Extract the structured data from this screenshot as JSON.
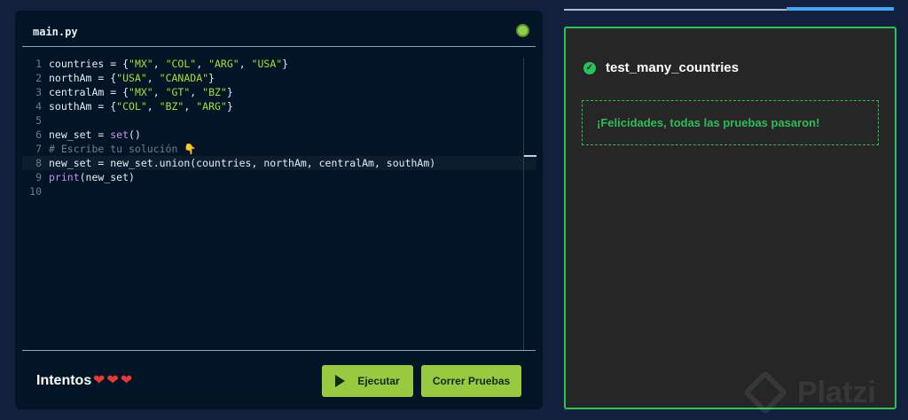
{
  "editor": {
    "file_name": "main.py",
    "lines": [
      {
        "num": "1",
        "tokens": [
          {
            "t": "countries = {",
            "c": "text"
          },
          {
            "t": "\"MX\"",
            "c": "str"
          },
          {
            "t": ", ",
            "c": "text"
          },
          {
            "t": "\"COL\"",
            "c": "str"
          },
          {
            "t": ", ",
            "c": "text"
          },
          {
            "t": "\"ARG\"",
            "c": "str"
          },
          {
            "t": ", ",
            "c": "text"
          },
          {
            "t": "\"USA\"",
            "c": "str"
          },
          {
            "t": "}",
            "c": "text"
          }
        ]
      },
      {
        "num": "2",
        "tokens": [
          {
            "t": "northAm = {",
            "c": "text"
          },
          {
            "t": "\"USA\"",
            "c": "str"
          },
          {
            "t": ", ",
            "c": "text"
          },
          {
            "t": "\"CANADA\"",
            "c": "str"
          },
          {
            "t": "}",
            "c": "text"
          }
        ]
      },
      {
        "num": "3",
        "tokens": [
          {
            "t": "centralAm = {",
            "c": "text"
          },
          {
            "t": "\"MX\"",
            "c": "str"
          },
          {
            "t": ", ",
            "c": "text"
          },
          {
            "t": "\"GT\"",
            "c": "str"
          },
          {
            "t": ", ",
            "c": "text"
          },
          {
            "t": "\"BZ\"",
            "c": "str"
          },
          {
            "t": "}",
            "c": "text"
          }
        ]
      },
      {
        "num": "4",
        "tokens": [
          {
            "t": "southAm = {",
            "c": "text"
          },
          {
            "t": "\"COL\"",
            "c": "str"
          },
          {
            "t": ", ",
            "c": "text"
          },
          {
            "t": "\"BZ\"",
            "c": "str"
          },
          {
            "t": ", ",
            "c": "text"
          },
          {
            "t": "\"ARG\"",
            "c": "str"
          },
          {
            "t": "}",
            "c": "text"
          }
        ]
      },
      {
        "num": "5",
        "tokens": []
      },
      {
        "num": "6",
        "tokens": [
          {
            "t": "new_set = ",
            "c": "text"
          },
          {
            "t": "set",
            "c": "fn"
          },
          {
            "t": "()",
            "c": "text"
          }
        ]
      },
      {
        "num": "7",
        "tokens": [
          {
            "t": "# Escribe tu solución 👇",
            "c": "cmt"
          }
        ]
      },
      {
        "num": "8",
        "active": true,
        "tokens": [
          {
            "t": "new_set = new_set.union(countries, northAm, centralAm, southAm)",
            "c": "text"
          }
        ]
      },
      {
        "num": "9",
        "tokens": [
          {
            "t": "print",
            "c": "fn"
          },
          {
            "t": "(new_set)",
            "c": "text"
          }
        ]
      },
      {
        "num": "10",
        "tokens": []
      }
    ]
  },
  "footer": {
    "attempts_label": "Intentos",
    "hearts": "❤❤❤",
    "run_label": "Ejecutar",
    "tests_label": "Correr Pruebas"
  },
  "results": {
    "test_name": "test_many_countries",
    "success_message": "¡Felicidades, todas las pruebas pasaron!"
  },
  "watermark": {
    "text": "Platzi"
  },
  "colors": {
    "accent": "#98ca3f",
    "success": "#28c45b",
    "tab_active": "#42a5f5"
  }
}
